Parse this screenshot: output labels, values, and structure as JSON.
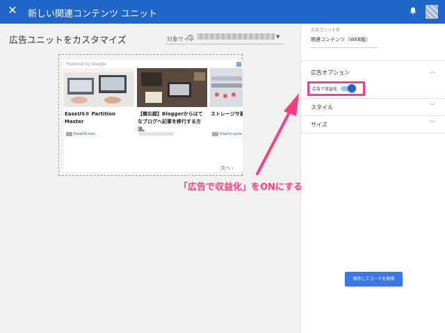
{
  "topbar": {
    "close_label": "✕",
    "title": "新しい関連コンテンツ ユニット"
  },
  "left": {
    "heading": "広告ユニットをカスタマイズ",
    "site_label": "対象サイト",
    "help_glyph": "?"
  },
  "preview": {
    "powered_by": "Powered by Google",
    "cards": [
      {
        "title": "EaseUS® Partition Master",
        "source": "EaseUS.com"
      },
      {
        "title": "【備忘録】Bloggerからはてなブログへ記事を移行する方法。",
        "source": ""
      },
      {
        "title": "ストレージサ最先端のストレ",
        "source": "hitachi-syste"
      }
    ],
    "next_label": "次へ"
  },
  "right": {
    "unit_name_label": "広告ユニット名",
    "unit_name_value": "関連コンテンツ（WEB版）",
    "ad_options_label": "広告オプション",
    "monetize_label": "広告で収益化",
    "monetize_enabled": true,
    "style_label": "スタイル",
    "size_label": "サイズ",
    "save_label": "保存してコードを取得"
  },
  "annotation": {
    "text": "「広告で収益化」をONにする",
    "color": "#ff3c7e"
  },
  "colors": {
    "topbar": "#1f66c8",
    "accent": "#3b78e7"
  }
}
